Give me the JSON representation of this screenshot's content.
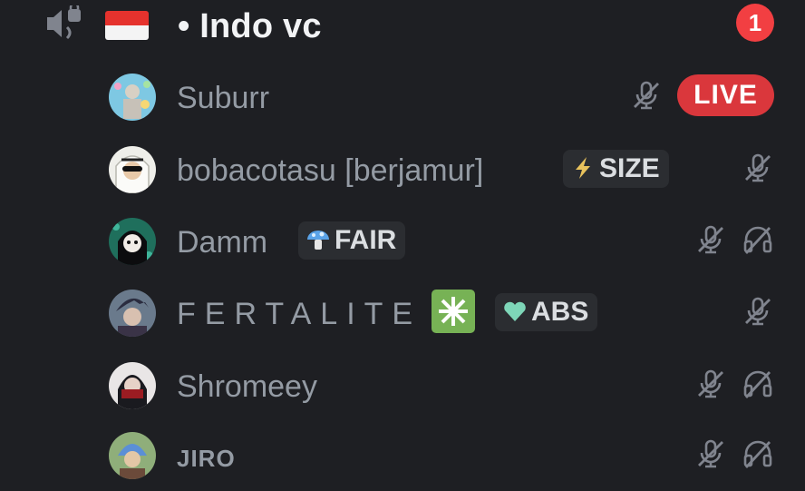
{
  "channel": {
    "name": "• Indo vc",
    "mentions": "1"
  },
  "users": [
    {
      "name": "Suburr",
      "status": "LIVE"
    },
    {
      "name": "bobacotasu [berjamur]",
      "tag": "SIZE"
    },
    {
      "name": "Damm",
      "tag": "FAIR"
    },
    {
      "name": "FERTALITE",
      "tag": "ABS"
    },
    {
      "name": "Shromeey"
    },
    {
      "name": "JIRO"
    }
  ]
}
